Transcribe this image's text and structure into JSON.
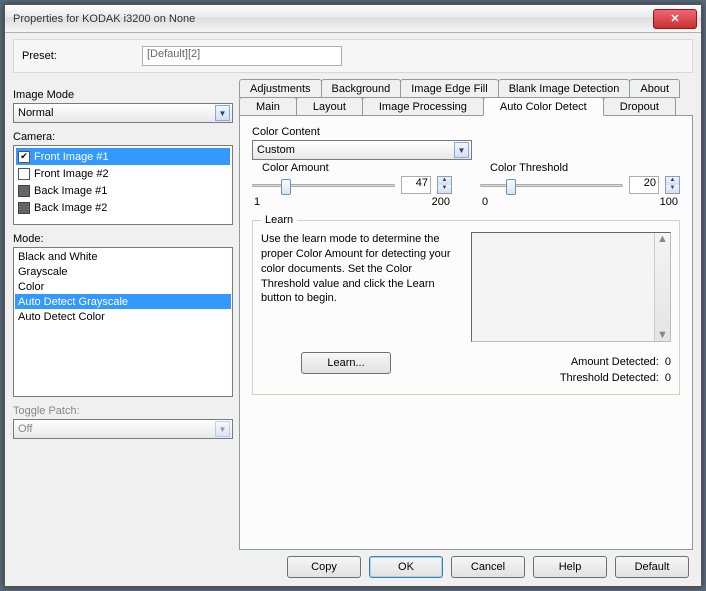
{
  "window": {
    "title": "Properties for KODAK i3200 on None"
  },
  "preset": {
    "label": "Preset:",
    "value": "[Default][2]"
  },
  "imageMode": {
    "label": "Image Mode",
    "value": "Normal"
  },
  "camera": {
    "label": "Camera:",
    "items": [
      {
        "label": "Front Image #1",
        "checked": true,
        "selected": true
      },
      {
        "label": "Front Image #2",
        "checked": false,
        "selected": false
      },
      {
        "label": "Back Image #1",
        "checked": false,
        "selected": false
      },
      {
        "label": "Back Image #2",
        "checked": false,
        "selected": false
      }
    ]
  },
  "mode": {
    "label": "Mode:",
    "items": [
      {
        "label": "Black and White",
        "selected": false
      },
      {
        "label": "Grayscale",
        "selected": false
      },
      {
        "label": "Color",
        "selected": false
      },
      {
        "label": "Auto Detect Grayscale",
        "selected": true
      },
      {
        "label": "Auto Detect Color",
        "selected": false
      }
    ]
  },
  "togglePatch": {
    "label": "Toggle Patch:",
    "value": "Off"
  },
  "tabs": {
    "row1": [
      "Adjustments",
      "Background",
      "Image Edge Fill",
      "Blank Image Detection",
      "About"
    ],
    "row2": [
      "Main",
      "Layout",
      "Image Processing",
      "Auto Color Detect",
      "Dropout"
    ],
    "active": "Auto Color Detect"
  },
  "colorContent": {
    "label": "Color Content",
    "value": "Custom"
  },
  "colorAmount": {
    "label": "Color Amount",
    "value": "47",
    "min": "1",
    "max": "200",
    "thumbPct": 20
  },
  "colorThreshold": {
    "label": "Color Threshold",
    "value": "20",
    "min": "0",
    "max": "100",
    "thumbPct": 18
  },
  "learn": {
    "legend": "Learn",
    "text": "Use the learn mode to determine the proper Color Amount for detecting your color documents. Set the Color Threshold value and click the Learn button to begin.",
    "button": "Learn...",
    "amountLabel": "Amount Detected:",
    "amountValue": "0",
    "thresholdLabel": "Threshold Detected:",
    "thresholdValue": "0"
  },
  "buttons": {
    "copy": "Copy",
    "ok": "OK",
    "cancel": "Cancel",
    "help": "Help",
    "default": "Default"
  }
}
